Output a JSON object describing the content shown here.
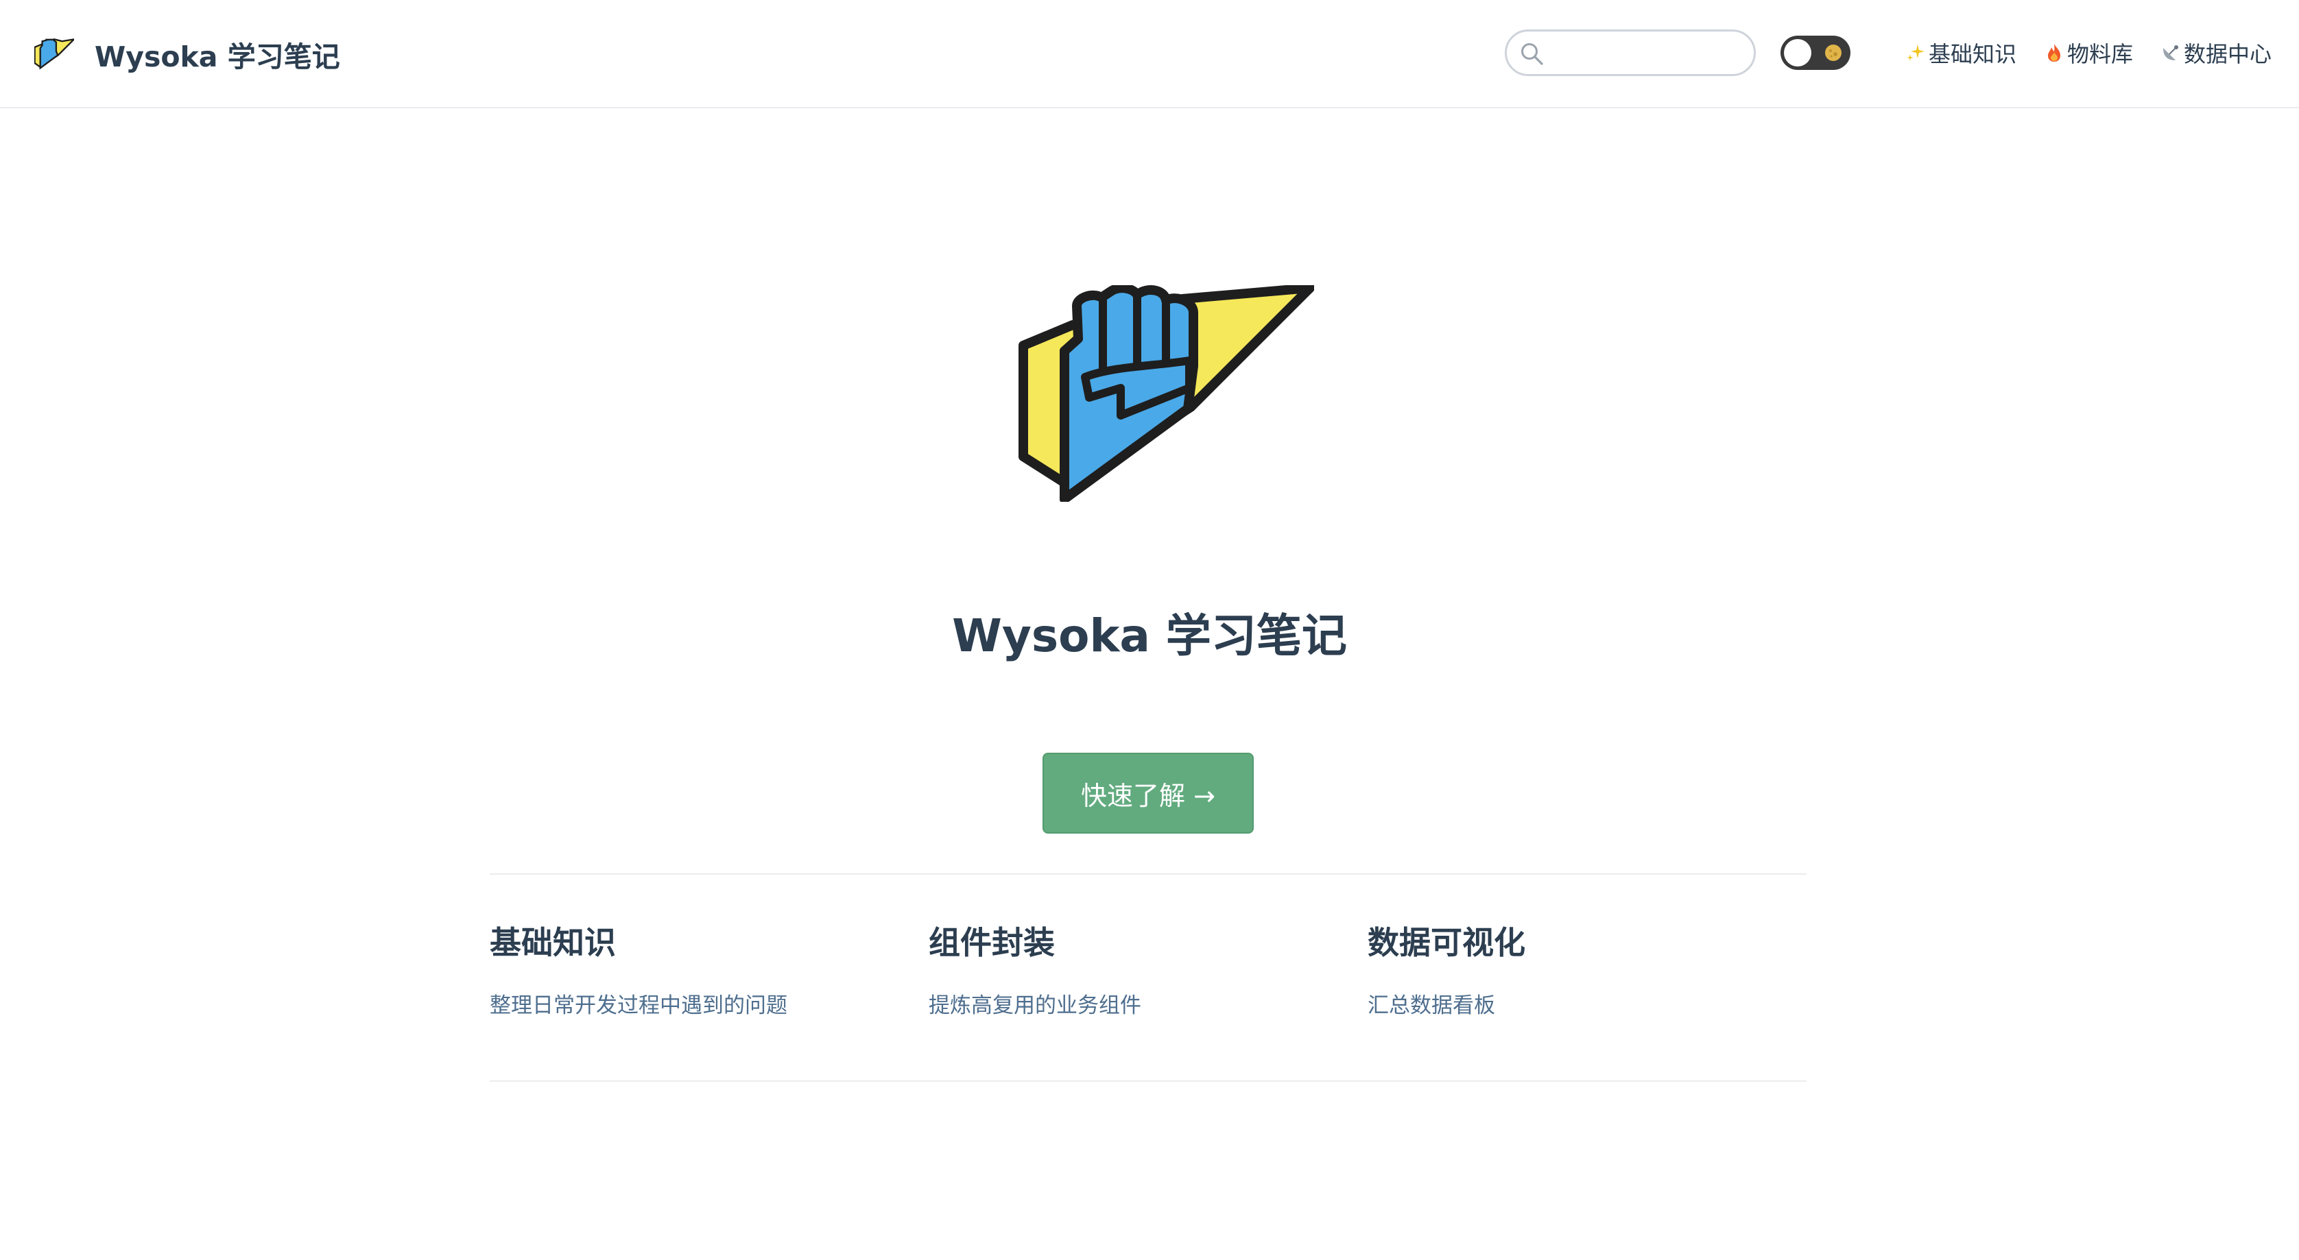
{
  "navbar": {
    "brand_title": "Wysoka 学习笔记",
    "search": {
      "value": "",
      "placeholder": ""
    },
    "links": [
      {
        "label": "基础知识",
        "icon": "sparkles-icon"
      },
      {
        "label": "物料库",
        "icon": "fire-icon"
      },
      {
        "label": "数据中心",
        "icon": "satellite-icon"
      }
    ],
    "theme_toggle": {
      "icon": "moon-icon",
      "state": "light"
    }
  },
  "hero": {
    "title": "Wysoka 学习笔记",
    "action_label": "快速了解 →"
  },
  "features": [
    {
      "title": "基础知识",
      "details": "整理日常开发过程中遇到的问题"
    },
    {
      "title": "组件封装",
      "details": "提炼高复用的业务组件"
    },
    {
      "title": "数据可视化",
      "details": "汇总数据看板"
    }
  ],
  "colors": {
    "accent": "#62ab7f",
    "text": "#2c3e50",
    "feature_desc": "#4e6e8e",
    "logo_blue": "#4aa9e8",
    "logo_yellow": "#f5e85a"
  }
}
